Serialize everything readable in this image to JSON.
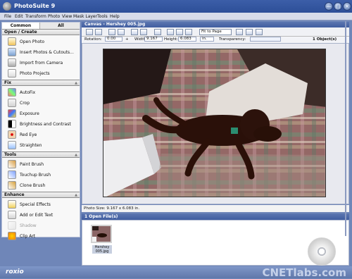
{
  "window": {
    "title": "PhotoSuite 9"
  },
  "menu": [
    "File",
    "Edit",
    "Transform",
    "Photo",
    "View",
    "Mask Layer",
    "Tools",
    "Help"
  ],
  "left_tabs": [
    "Common",
    "All"
  ],
  "sections": {
    "open_create": {
      "title": "Open / Create",
      "items": [
        "Open Photo",
        "Insert Photos & Cutouts...",
        "Import from Camera",
        "Photo Projects"
      ]
    },
    "fix": {
      "title": "Fix",
      "items": [
        "AutoFix",
        "Crop",
        "Exposure",
        "Brightness and Contrast",
        "Red Eye",
        "Straighten"
      ]
    },
    "tools": {
      "title": "Tools",
      "items": [
        "Paint Brush",
        "Touchup Brush",
        "Clone Brush"
      ]
    },
    "enhance": {
      "title": "Enhance",
      "items": [
        "Special Effects",
        "Add or Edit Text",
        "Shadow",
        "Clip Art"
      ]
    }
  },
  "canvas": {
    "title": "Canvas - Hershey 005.jpg",
    "fit_select": "Fit to Page"
  },
  "props": {
    "rotation_label": "Rotation:",
    "rotation_value": "0.00",
    "width_label": "Width:",
    "width_value": "9.167",
    "height_label": "Height:",
    "height_value": "6.083",
    "unit": "in.",
    "transparency_label": "Transparency:",
    "objects": "1 Object(s)"
  },
  "status": {
    "photo_size": "Photo Size: 9.167 x 6.083 in."
  },
  "open_files": {
    "title": "1 Open File(s)",
    "thumb_label": "Hershey 005.jpg"
  },
  "footer": {
    "brand": "roxio",
    "watermark": "CNETlabs.com"
  }
}
